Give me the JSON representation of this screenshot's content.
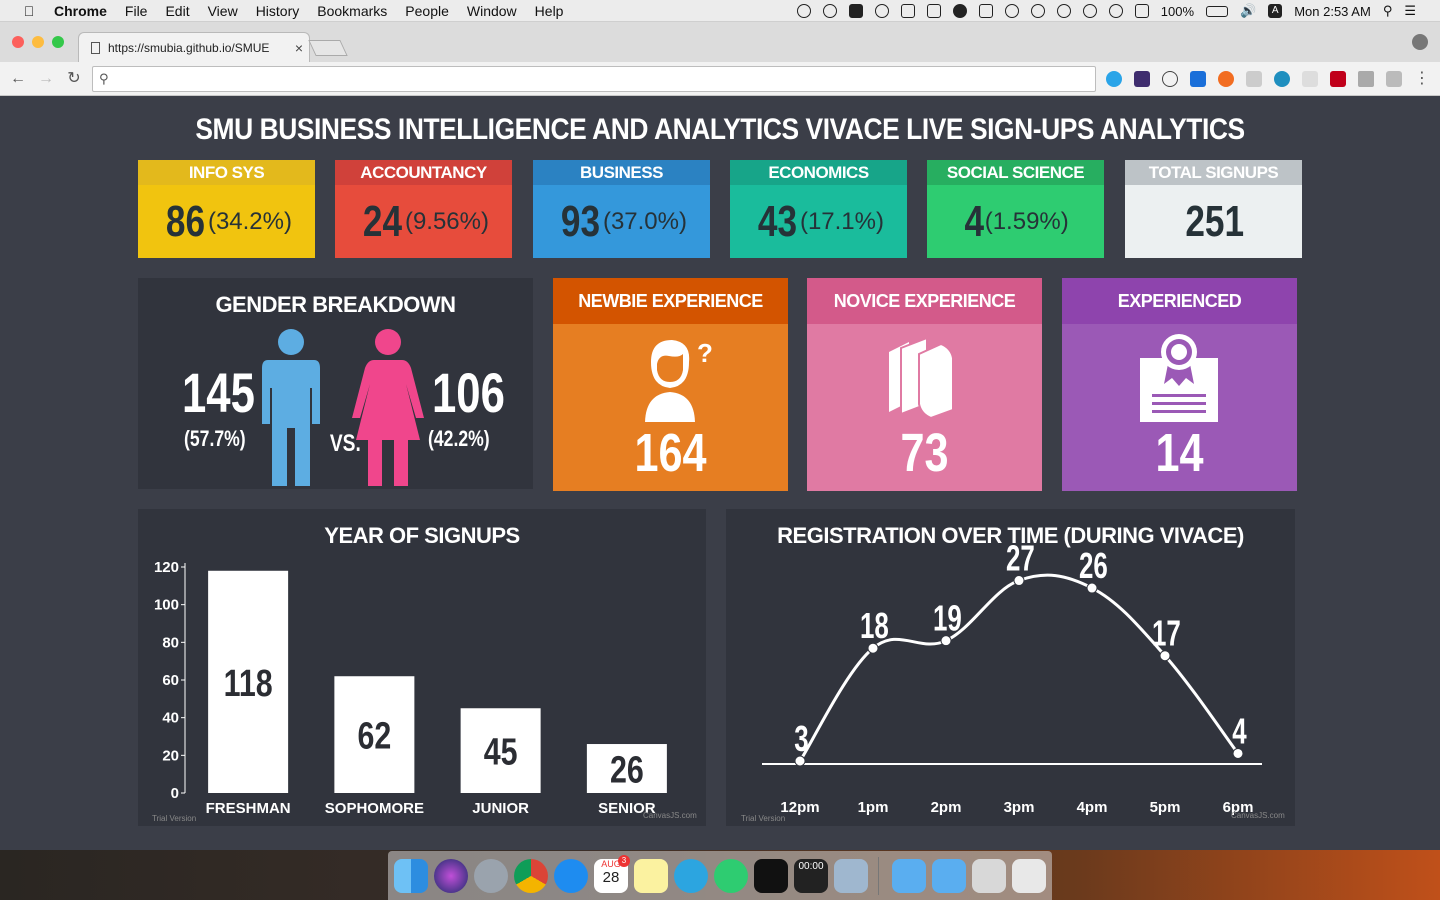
{
  "menubar": {
    "app": "Chrome",
    "menus": [
      "File",
      "Edit",
      "View",
      "History",
      "Bookmarks",
      "People",
      "Window",
      "Help"
    ],
    "battery": "100%",
    "clock": "Mon 2:53 AM"
  },
  "browser": {
    "tab_title": "https://smubia.github.io/SMUE",
    "tab_close": "×",
    "url": ""
  },
  "page": {
    "title": "SMU BUSINESS INTELLIGENCE AND ANALYTICS VIVACE LIVE SIGN-UPS ANALYTICS",
    "stats": [
      {
        "label": "INFO SYS",
        "value": "86",
        "pct": "(34.2%)",
        "head_color": "#e3b91c",
        "body_color": "#f1c40f"
      },
      {
        "label": "ACCOUNTANCY",
        "value": "24",
        "pct": "(9.56%)",
        "head_color": "#d0413a",
        "body_color": "#e74c3c"
      },
      {
        "label": "BUSINESS",
        "value": "93",
        "pct": "(37.0%)",
        "head_color": "#2b82c2",
        "body_color": "#3498db"
      },
      {
        "label": "ECONOMICS",
        "value": "43",
        "pct": "(17.1%)",
        "head_color": "#17a589",
        "body_color": "#1abc9c"
      },
      {
        "label": "SOCIAL SCIENCE",
        "value": "4",
        "pct": "(1.59%)",
        "head_color": "#27ae60",
        "body_color": "#2ecc71"
      },
      {
        "label": "TOTAL SIGNUPS",
        "value": "251",
        "pct": "",
        "head_color": "#bdc3c7",
        "body_color": "#ecf0f1"
      }
    ],
    "gender": {
      "title": "GENDER BREAKDOWN",
      "male_count": "145",
      "male_pct": "(57.7%)",
      "female_count": "106",
      "female_pct": "(42.2%)",
      "vs": "VS.",
      "male_color": "#5dade2",
      "female_color": "#f0468c"
    },
    "experience": [
      {
        "label": "NEWBIE EXPERIENCE",
        "value": "164",
        "icon": "person-question-icon",
        "head_color": "#d35400",
        "body_color": "#e67e22"
      },
      {
        "label": "NOVICE EXPERIENCE",
        "value": "73",
        "icon": "books-icon",
        "head_color": "#d35a8a",
        "body_color": "#e07aa3"
      },
      {
        "label": "EXPERIENCED",
        "value": "14",
        "icon": "certificate-icon",
        "head_color": "#8e44ad",
        "body_color": "#9b59b6"
      }
    ],
    "trial_label": "Trial Version",
    "canvas_label": "CanvasJS.com"
  },
  "chart_data": [
    {
      "type": "bar",
      "title": "YEAR OF SIGNUPS",
      "categories": [
        "FRESHMAN",
        "SOPHOMORE",
        "JUNIOR",
        "SENIOR"
      ],
      "values": [
        118,
        62,
        45,
        26
      ],
      "ylim": [
        0,
        120
      ],
      "yticks": [
        0,
        20,
        40,
        60,
        80,
        100,
        120
      ],
      "xlabel": "",
      "ylabel": "",
      "bar_color": "#ffffff"
    },
    {
      "type": "line",
      "title": "REGISTRATION OVER TIME (DURING VIVACE)",
      "categories": [
        "12pm",
        "1pm",
        "2pm",
        "3pm",
        "4pm",
        "5pm",
        "6pm"
      ],
      "values": [
        3,
        18,
        19,
        27,
        26,
        17,
        4
      ],
      "xlabel": "",
      "ylabel": "",
      "line_color": "#ffffff"
    }
  ],
  "dock": {
    "calendar_month": "AUG",
    "calendar_day": "28",
    "calendar_badge": "3",
    "clock_widget": "00:00"
  }
}
